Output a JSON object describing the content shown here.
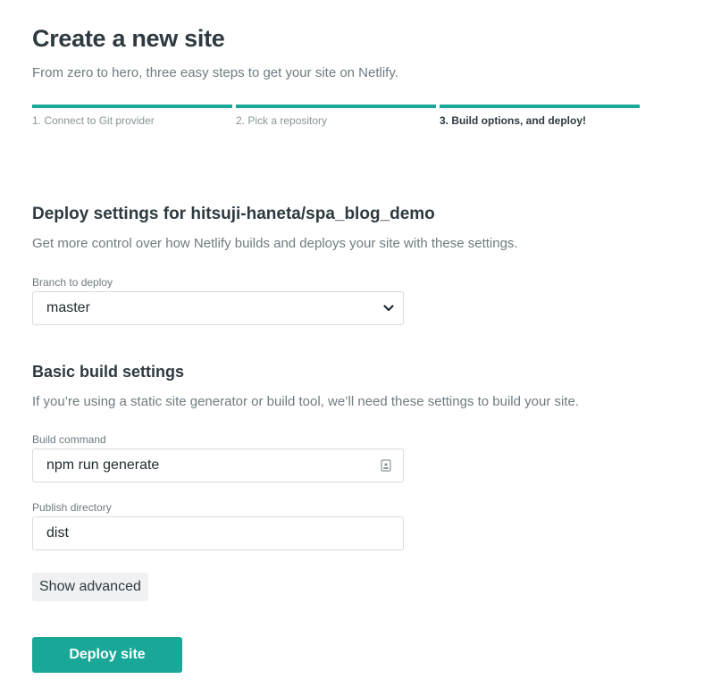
{
  "header": {
    "title": "Create a new site",
    "subtitle": "From zero to hero, three easy steps to get your site on Netlify."
  },
  "steps": [
    {
      "label": "1. Connect to Git provider",
      "active": false
    },
    {
      "label": "2. Pick a repository",
      "active": false
    },
    {
      "label": "3. Build options, and deploy!",
      "active": true
    }
  ],
  "deploy_settings": {
    "title": "Deploy settings for hitsuji-haneta/spa_blog_demo",
    "description": "Get more control over how Netlify builds and deploys your site with these settings.",
    "branch_label": "Branch to deploy",
    "branch_value": "master"
  },
  "build_settings": {
    "title": "Basic build settings",
    "description": "If you’re using a static site generator or build tool, we’ll need these settings to build your site.",
    "build_command_label": "Build command",
    "build_command_value": "npm run generate",
    "publish_directory_label": "Publish directory",
    "publish_directory_value": "dist"
  },
  "actions": {
    "show_advanced_label": "Show advanced",
    "deploy_label": "Deploy site"
  },
  "colors": {
    "accent": "#19a897",
    "text": "#2e3a40",
    "muted": "#6f7b80"
  },
  "icons": {
    "branch_select": "chevron-down-icon",
    "build_command_field": "lock-icon"
  }
}
